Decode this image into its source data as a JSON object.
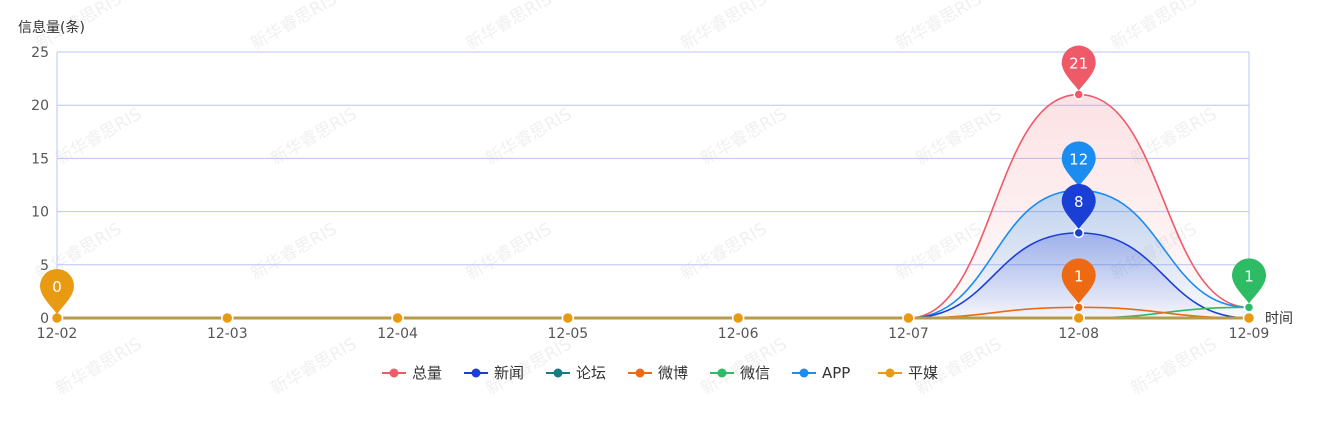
{
  "chart_data": {
    "type": "line",
    "ylabel": "信息量(条)",
    "xlabel": "时间",
    "categories": [
      "12-02",
      "12-03",
      "12-04",
      "12-05",
      "12-06",
      "12-07",
      "12-08",
      "12-09"
    ],
    "ylim": [
      0,
      25
    ],
    "yticks": [
      0,
      5,
      10,
      15,
      20,
      25
    ],
    "grid": true,
    "legend_position": "bottom",
    "smooth": true,
    "series": [
      {
        "name": "总量",
        "color": "#ee5a68",
        "values": [
          0,
          0,
          0,
          0,
          0,
          0,
          21,
          1
        ],
        "area": true,
        "max_label": 21
      },
      {
        "name": "新闻",
        "color": "#1a3fd4",
        "values": [
          0,
          0,
          0,
          0,
          0,
          0,
          8,
          0
        ],
        "area": true,
        "max_label": 8
      },
      {
        "name": "论坛",
        "color": "#167c84",
        "values": [
          0,
          0,
          0,
          0,
          0,
          0,
          0,
          0
        ],
        "area": false
      },
      {
        "name": "微博",
        "color": "#ee6a12",
        "values": [
          0,
          0,
          0,
          0,
          0,
          0,
          1,
          0
        ],
        "area": false,
        "max_label": 1
      },
      {
        "name": "微信",
        "color": "#2dbb64",
        "values": [
          0,
          0,
          0,
          0,
          0,
          0,
          0,
          1
        ],
        "area": false,
        "max_label": 1
      },
      {
        "name": "APP",
        "color": "#1b8cf0",
        "values": [
          0,
          0,
          0,
          0,
          0,
          0,
          12,
          1
        ],
        "area": true,
        "max_label": 12
      },
      {
        "name": "平媒",
        "color": "#e89a12",
        "values": [
          0,
          0,
          0,
          0,
          0,
          0,
          0,
          0
        ],
        "area": false,
        "max_label": 0
      }
    ]
  },
  "watermark": "新华睿思RIS"
}
